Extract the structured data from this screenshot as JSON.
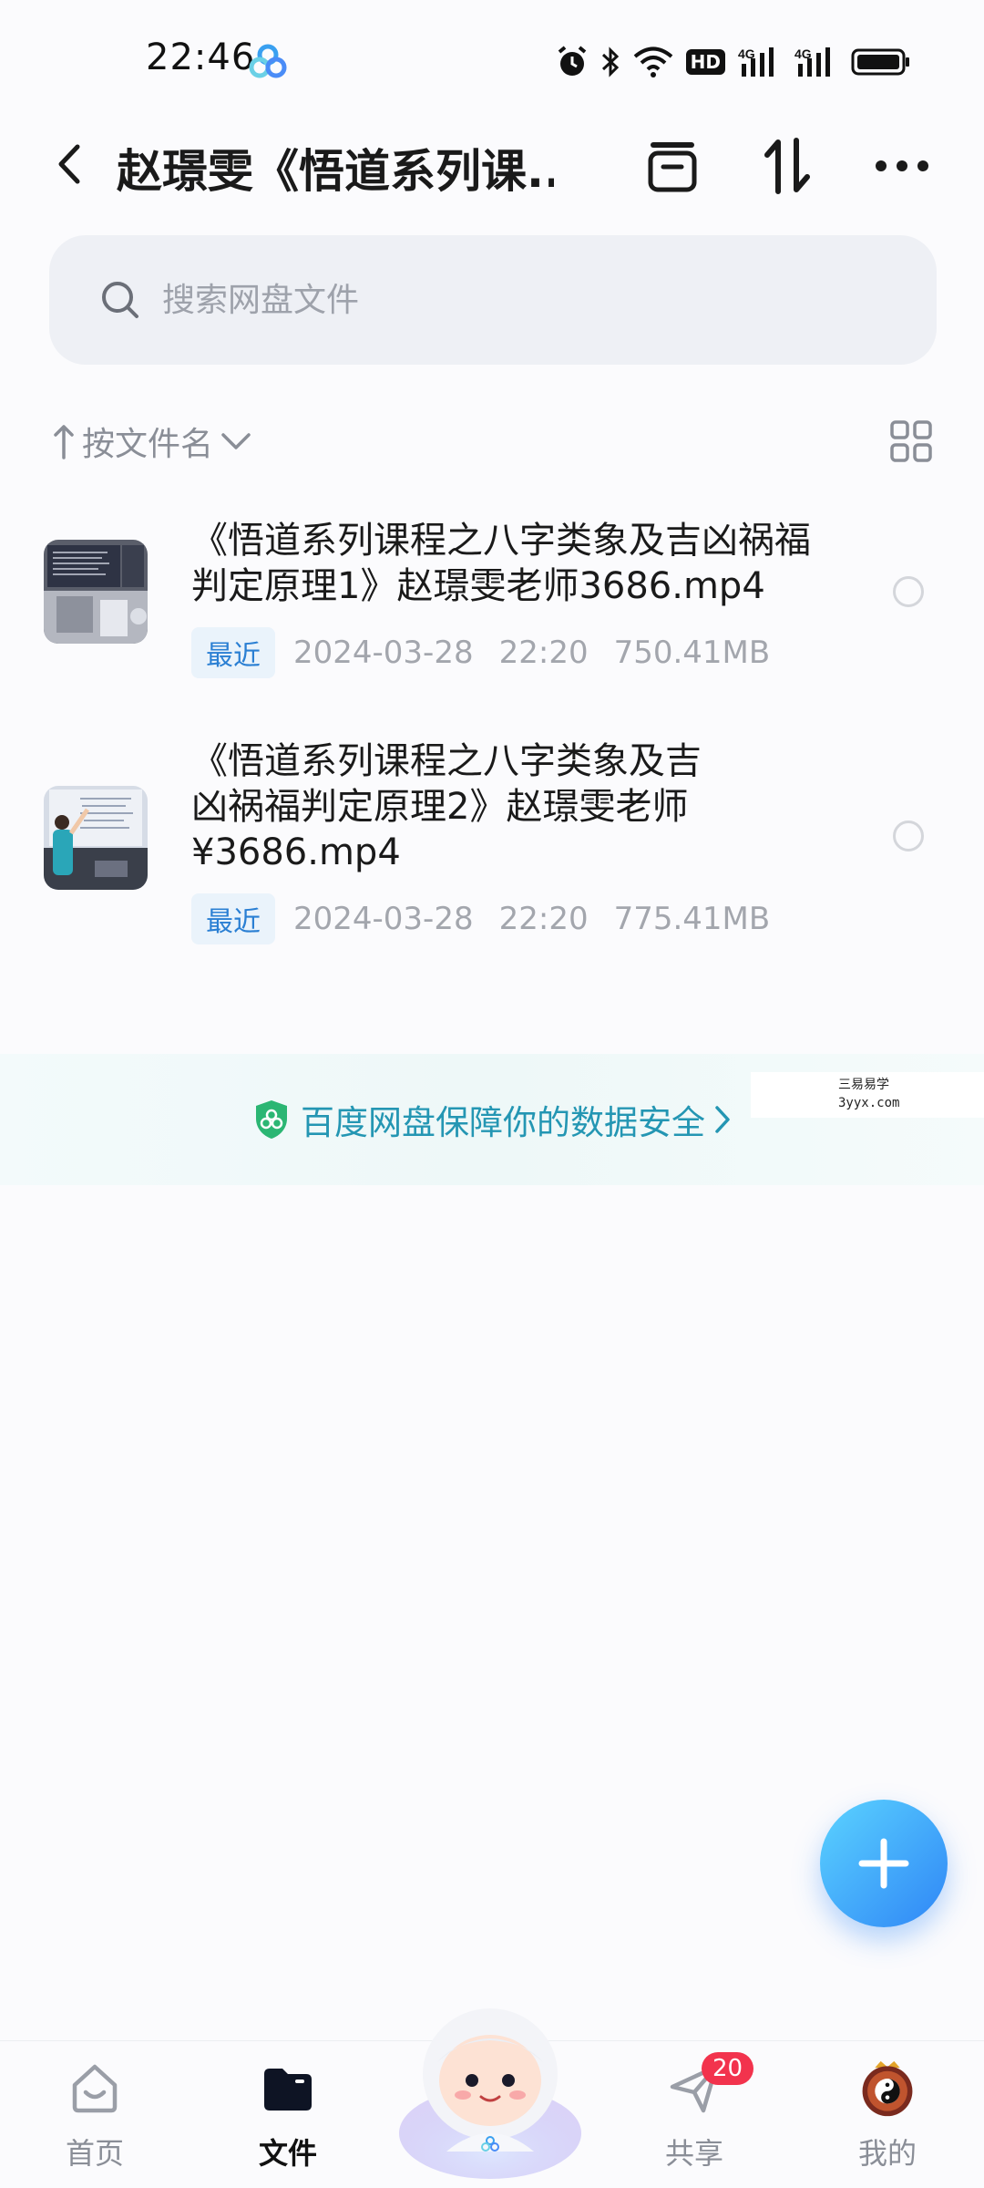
{
  "status_bar": {
    "time": "22:46",
    "hd_label": "HD",
    "network_labels": [
      "4G",
      "4G"
    ]
  },
  "header": {
    "title": "赵璟雯《悟道系列课..."
  },
  "search": {
    "placeholder": "搜索网盘文件"
  },
  "sort": {
    "label": "按文件名"
  },
  "files": [
    {
      "name": "《悟道系列课程之八字类象及吉凶祸福判定原理1》赵璟雯老师3686.mp4",
      "badge": "最近",
      "date": "2024-03-28",
      "time": "22:20",
      "size": "750.41MB"
    },
    {
      "name": "《悟道系列课程之八字类象及吉凶祸福判定原理2》赵璟雯老师¥3686.mp4",
      "badge": "最近",
      "date": "2024-03-28",
      "time": "22:20",
      "size": "775.41MB"
    }
  ],
  "security_banner": {
    "text": "百度网盘保障你的数据安全"
  },
  "watermark": {
    "line1": "三易易学",
    "line2": "3yyx.com"
  },
  "bottom_nav": {
    "items": [
      {
        "label": "首页",
        "active": false
      },
      {
        "label": "文件",
        "active": true
      },
      {
        "label": "共享",
        "active": false,
        "badge": "20"
      },
      {
        "label": "我的",
        "active": false
      }
    ]
  },
  "colors": {
    "accent": "#2f86f6",
    "banner_text": "#2496b3",
    "badge_red": "#f2334d"
  }
}
